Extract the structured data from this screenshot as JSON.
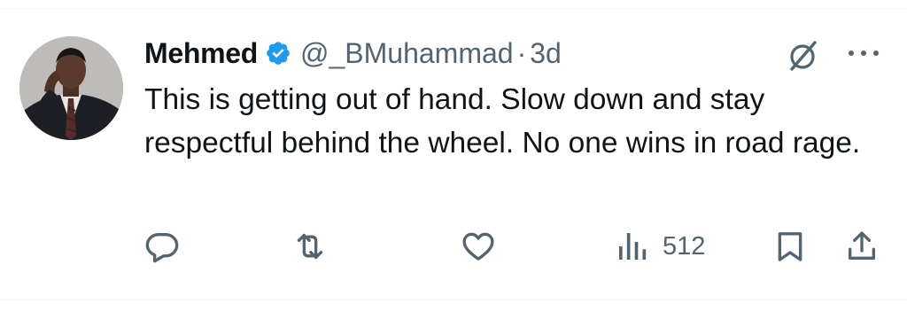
{
  "tweet": {
    "author": {
      "display_name": "Mehmed",
      "verified": true,
      "handle": "@_BMuhammad",
      "separator": "·",
      "time": "3d"
    },
    "text": "This is getting out of hand. Slow down and stay respectful behind the wheel. No one wins in road rage.",
    "actions": {
      "reply_icon": "reply-icon",
      "repost_icon": "repost-icon",
      "like_icon": "heart-icon",
      "views_icon": "views-icon",
      "views_count": "512",
      "bookmark_icon": "bookmark-icon",
      "share_icon": "share-icon"
    }
  },
  "colors": {
    "text_primary": "#0f1419",
    "text_secondary": "#536471",
    "verified_blue": "#1d9bf0",
    "divider": "#eff3f4"
  }
}
